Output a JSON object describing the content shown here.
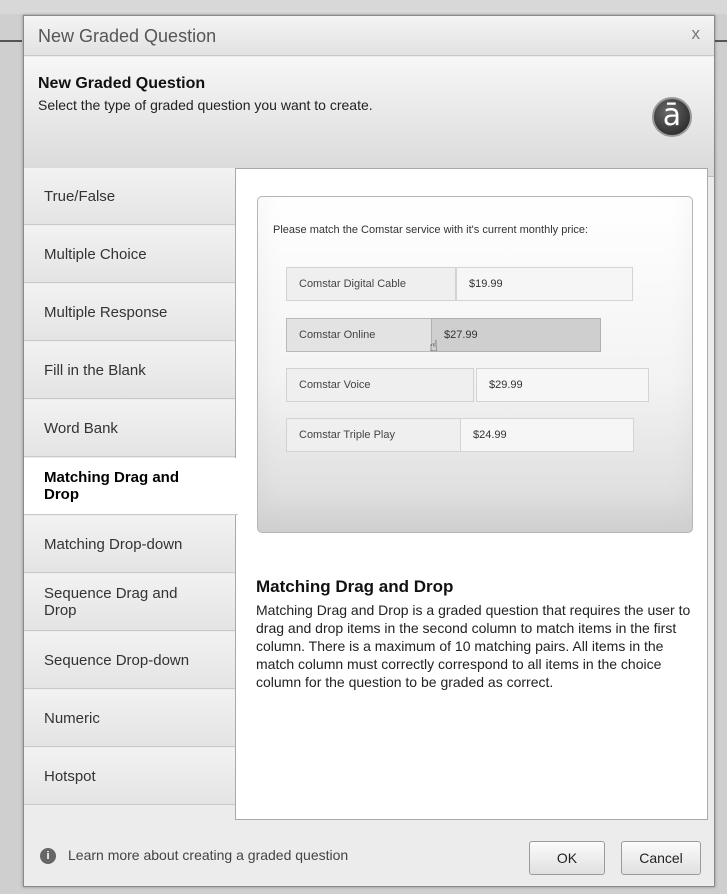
{
  "window": {
    "title": "New Graded Question",
    "close_label": "x"
  },
  "header": {
    "title": "New Graded Question",
    "subtitle": "Select the type of graded question you want to create.",
    "logo_glyph": "ā"
  },
  "sidebar": {
    "selected_index": 5,
    "items": [
      {
        "label": "True/False"
      },
      {
        "label": "Multiple Choice"
      },
      {
        "label": "Multiple Response"
      },
      {
        "label": "Fill in the Blank"
      },
      {
        "label": "Word Bank"
      },
      {
        "label": "Matching Drag and Drop"
      },
      {
        "label": "Matching Drop-down"
      },
      {
        "label": "Sequence Drag and Drop"
      },
      {
        "label": "Sequence Drop-down"
      },
      {
        "label": "Numeric"
      },
      {
        "label": "Hotspot"
      }
    ]
  },
  "preview": {
    "question": "Please match the Comstar service with it's current monthly price:",
    "pairs": [
      {
        "item": "Comstar Digital Cable",
        "price": "$19.99"
      },
      {
        "item": "Comstar Online",
        "price": "$27.99"
      },
      {
        "item": "Comstar Voice",
        "price": "$29.99"
      },
      {
        "item": "Comstar Triple Play",
        "price": "$24.99"
      }
    ]
  },
  "description": {
    "title": "Matching Drag and Drop",
    "body": "Matching Drag and Drop is a graded question that requires the user to drag and drop items in the second column to match items in the first column. There is a maximum of 10 matching pairs. All items in the match column must correctly correspond to all items in the choice column for the question to be graded as correct."
  },
  "footer": {
    "learn_more": "Learn more about creating a graded question",
    "ok_label": "OK",
    "cancel_label": "Cancel"
  },
  "icons": {
    "info": "info-icon",
    "close": "close-icon",
    "cursor": "hand-cursor-icon",
    "logo": "articulate-logo"
  }
}
